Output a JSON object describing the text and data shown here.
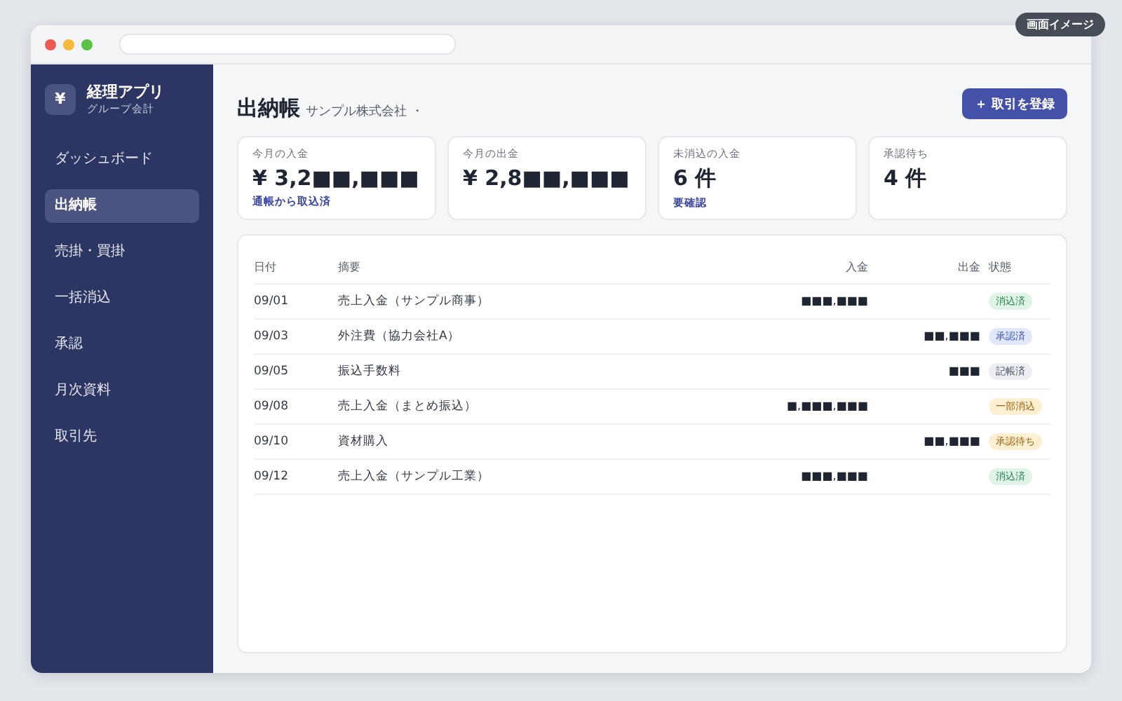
{
  "badge": "画面イメージ",
  "app": {
    "logo": "¥",
    "name": "経理アプリ",
    "subtitle": "グループ会計"
  },
  "sidebar": {
    "items": [
      {
        "label": "ダッシュボード",
        "selected": false
      },
      {
        "label": "出納帳",
        "selected": true
      },
      {
        "label": "売掛・買掛",
        "selected": false
      },
      {
        "label": "一括消込",
        "selected": false
      },
      {
        "label": "承認",
        "selected": false
      },
      {
        "label": "月次資料",
        "selected": false
      },
      {
        "label": "取引先",
        "selected": false
      }
    ]
  },
  "header": {
    "title": "出納帳",
    "company": "サンプル株式会社 ・",
    "button": "＋ 取引を登録"
  },
  "cards": [
    {
      "label": "今月の入金",
      "value": "¥ 3,2■■,■■■",
      "note": "通帳から取込済"
    },
    {
      "label": "今月の出金",
      "value": "¥ 2,8■■,■■■"
    },
    {
      "label": "未消込の入金",
      "value": "6 件",
      "note": "要確認"
    },
    {
      "label": "承認待ち",
      "value": "4 件"
    }
  ],
  "table": {
    "columns": [
      "日付",
      "摘要",
      "入金",
      "出金",
      "状態"
    ],
    "rows": [
      {
        "date": "09/01",
        "summary": "売上入金（サンプル商事）",
        "in": "■■■,■■■",
        "status": {
          "label": "消込済",
          "kind": "reconciled"
        }
      },
      {
        "date": "09/03",
        "summary": "外注費（協力会社A）",
        "out": "■■,■■■",
        "status": {
          "label": "承認済",
          "kind": "approved"
        }
      },
      {
        "date": "09/05",
        "summary": "振込手数料",
        "out": "■■■",
        "status": {
          "label": "記帳済",
          "kind": "posted"
        }
      },
      {
        "date": "09/08",
        "summary": "売上入金（まとめ振込）",
        "in": "■,■■■,■■■",
        "status": {
          "label": "一部消込",
          "kind": "partial"
        }
      },
      {
        "date": "09/10",
        "summary": "資材購入",
        "out": "■■,■■■",
        "status": {
          "label": "承認待ち",
          "kind": "pending"
        }
      },
      {
        "date": "09/12",
        "summary": "売上入金（サンプル工業）",
        "in": "■■■,■■■",
        "status": {
          "label": "消込済",
          "kind": "reconciled"
        }
      }
    ]
  }
}
